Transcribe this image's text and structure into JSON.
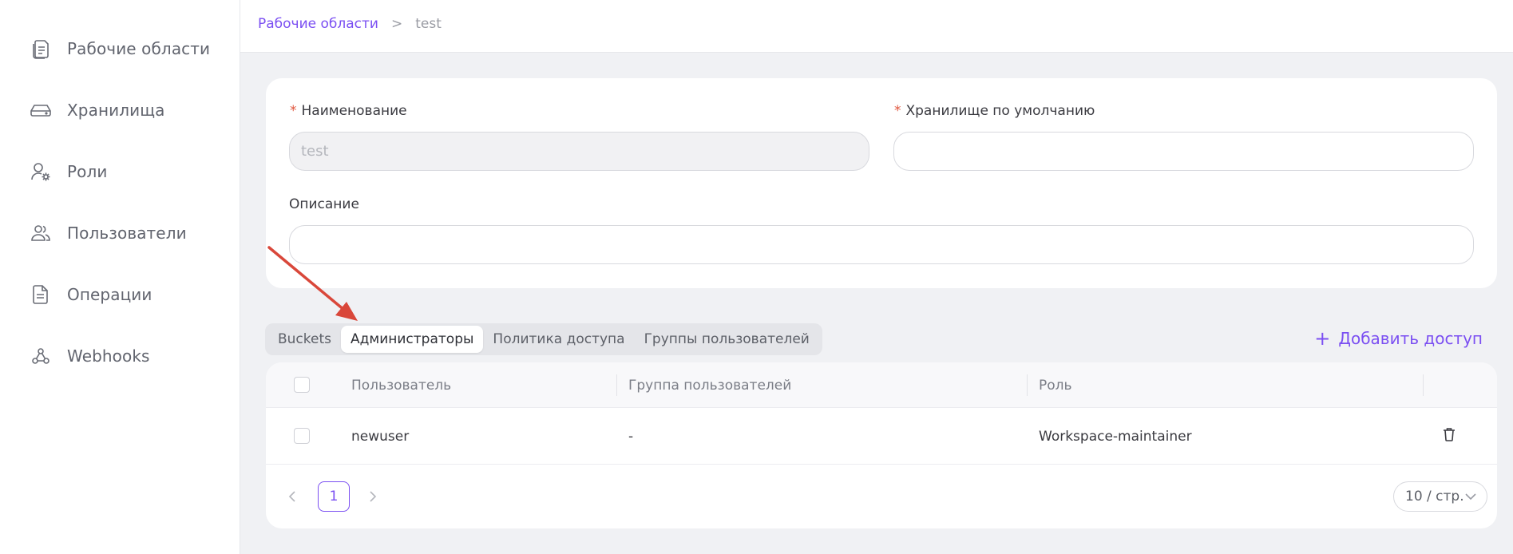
{
  "sidebar": {
    "items": [
      {
        "label": "Рабочие области",
        "icon": "document-stack-icon"
      },
      {
        "label": "Хранилища",
        "icon": "storage-drive-icon"
      },
      {
        "label": "Роли",
        "icon": "user-gear-icon"
      },
      {
        "label": "Пользователи",
        "icon": "users-icon"
      },
      {
        "label": "Операции",
        "icon": "document-icon"
      },
      {
        "label": "Webhooks",
        "icon": "webhook-icon"
      }
    ]
  },
  "breadcrumb": {
    "parent": "Рабочие области",
    "separator": ">",
    "current": "test"
  },
  "form": {
    "name_label": "Наименование",
    "name_value": "test",
    "storage_label": "Хранилище по умолчанию",
    "storage_value": "",
    "description_label": "Описание",
    "description_value": "",
    "required_mark": "*"
  },
  "tabs": [
    {
      "label": "Buckets",
      "active": false
    },
    {
      "label": "Администраторы",
      "active": true
    },
    {
      "label": "Политика доступа",
      "active": false
    },
    {
      "label": "Группы пользователей",
      "active": false
    }
  ],
  "actions": {
    "add_access_label": "Добавить доступ",
    "add_access_icon": "plus-icon"
  },
  "table": {
    "columns": [
      "Пользователь",
      "Группа пользователей",
      "Роль"
    ],
    "rows": [
      {
        "user": "newuser",
        "group": "-",
        "role": "Workspace-maintainer",
        "action_icon": "trash-icon"
      }
    ]
  },
  "pagination": {
    "current_page": "1",
    "page_size": "10 / стр."
  },
  "colors": {
    "accent": "#7b4ff2",
    "required": "#e0563d",
    "annotation_arrow": "#d9473a"
  }
}
